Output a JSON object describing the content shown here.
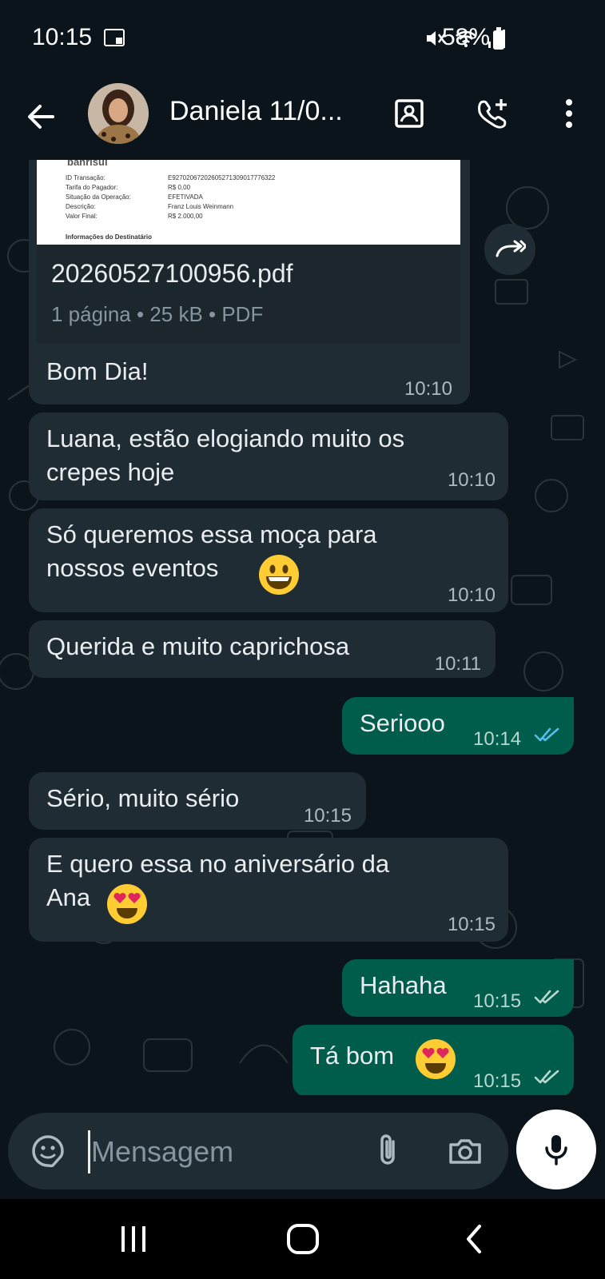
{
  "status_bar": {
    "time": "10:15",
    "battery": "58%",
    "icons": [
      "voicemail-icon",
      "mute-icon",
      "wifi-icon",
      "signal-icon",
      "battery-icon"
    ]
  },
  "header": {
    "contact_name": "Daniela 11/0...",
    "icons": [
      "back-arrow-icon",
      "contact-card-icon",
      "add-call-icon",
      "more-vertical-icon"
    ]
  },
  "pdf_message": {
    "preview_lines": [
      {
        "label": "banrisul",
        "value": ""
      },
      {
        "label": "ID Transação:",
        "value": "E92702067202605271309017776322"
      },
      {
        "label": "Tarifa do Pagador:",
        "value": "R$ 0,00"
      },
      {
        "label": "Situação da Operação:",
        "value": "EFETIVADA"
      },
      {
        "label": "Descrição:",
        "value": "Franz Louis Weinmann"
      },
      {
        "label": "Valor Final:",
        "value": "R$ 2.000,00"
      },
      {
        "label": "Informações do Destinatário",
        "value": ""
      }
    ],
    "file_name": "20260527100956.pdf",
    "file_meta": "1 página • 25 kB • PDF"
  },
  "messages": [
    {
      "direction": "in",
      "text": "Bom Dia!",
      "time": "10:10"
    },
    {
      "direction": "in",
      "text_lines": [
        "Luana, estão elogiando muito os",
        "crepes hoje"
      ],
      "time": "10:10"
    },
    {
      "direction": "in",
      "text_lines": [
        "Só queremos essa moça para",
        "nossos eventos"
      ],
      "emoji": "grinning-face",
      "time": "10:10"
    },
    {
      "direction": "in",
      "text": "Querida e muito caprichosa",
      "time": "10:11"
    },
    {
      "direction": "out",
      "text": "Seriooo",
      "time": "10:14",
      "status": "read"
    },
    {
      "direction": "in",
      "text": "Sério, muito sério",
      "time": "10:15"
    },
    {
      "direction": "in",
      "text_lines": [
        "E quero essa no aniversário da",
        "Ana"
      ],
      "emoji": "heart-eyes",
      "time": "10:15"
    },
    {
      "direction": "out",
      "text": "Hahaha",
      "time": "10:15",
      "status": "delivered"
    },
    {
      "direction": "out",
      "text": "Tá bom",
      "emoji": "heart-eyes",
      "time": "10:15",
      "status": "delivered"
    }
  ],
  "composer": {
    "placeholder": "Mensagem",
    "icons": [
      "sticker-icon",
      "attach-icon",
      "camera-icon",
      "mic-icon"
    ]
  },
  "colors": {
    "background": "#0b141a",
    "incoming_bubble": "#202c33",
    "outgoing_bubble": "#005c4b",
    "read_ticks": "#53bdeb",
    "delivered_ticks": "#b8d8cf"
  }
}
